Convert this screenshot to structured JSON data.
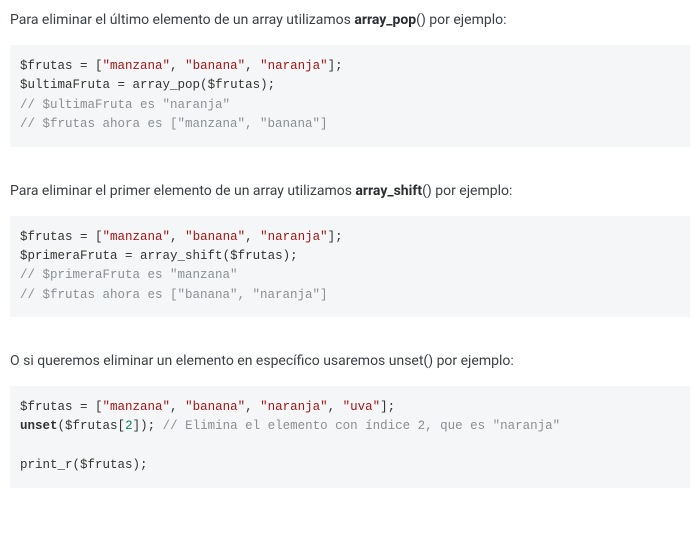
{
  "sections": [
    {
      "intro_pre": "Para eliminar el último elemento de un array utilizamos ",
      "intro_bold": "array_pop",
      "intro_post": "() por ejemplo:",
      "code": {
        "assign_var": "$frutas",
        "array_items": [
          "\"manzana\"",
          "\"banana\"",
          "\"naranja\""
        ],
        "op_var": "$ultimaFruta",
        "op_func": "array_pop",
        "op_arg": "$frutas",
        "comment1": "// $ultimaFruta es \"naranja\"",
        "comment2": "// $frutas ahora es [\"manzana\", \"banana\"]"
      }
    },
    {
      "intro_pre": "Para eliminar el primer elemento de un array utilizamos ",
      "intro_bold": "array_shift",
      "intro_post": "() por ejemplo:",
      "code": {
        "assign_var": "$frutas",
        "array_items": [
          "\"manzana\"",
          "\"banana\"",
          "\"naranja\""
        ],
        "op_var": "$primeraFruta",
        "op_func": "array_shift",
        "op_arg": "$frutas",
        "comment1": "// $primeraFruta es \"manzana\"",
        "comment2": "// $frutas ahora es [\"banana\", \"naranja\"]"
      }
    },
    {
      "intro_pre": "O si queremos eliminar un elemento en específico usaremos unset() por ejemplo:",
      "intro_bold": "",
      "intro_post": "",
      "code_unset": {
        "assign_var": "$frutas",
        "array_items": [
          "\"manzana\"",
          "\"banana\"",
          "\"naranja\"",
          "\"uva\""
        ],
        "unset_kw": "unset",
        "unset_target_var": "$frutas",
        "unset_target_idx": "2",
        "unset_comment": "// Elimina el elemento con índice 2, que es \"naranja\"",
        "print_line": "print_r($frutas);"
      }
    }
  ]
}
